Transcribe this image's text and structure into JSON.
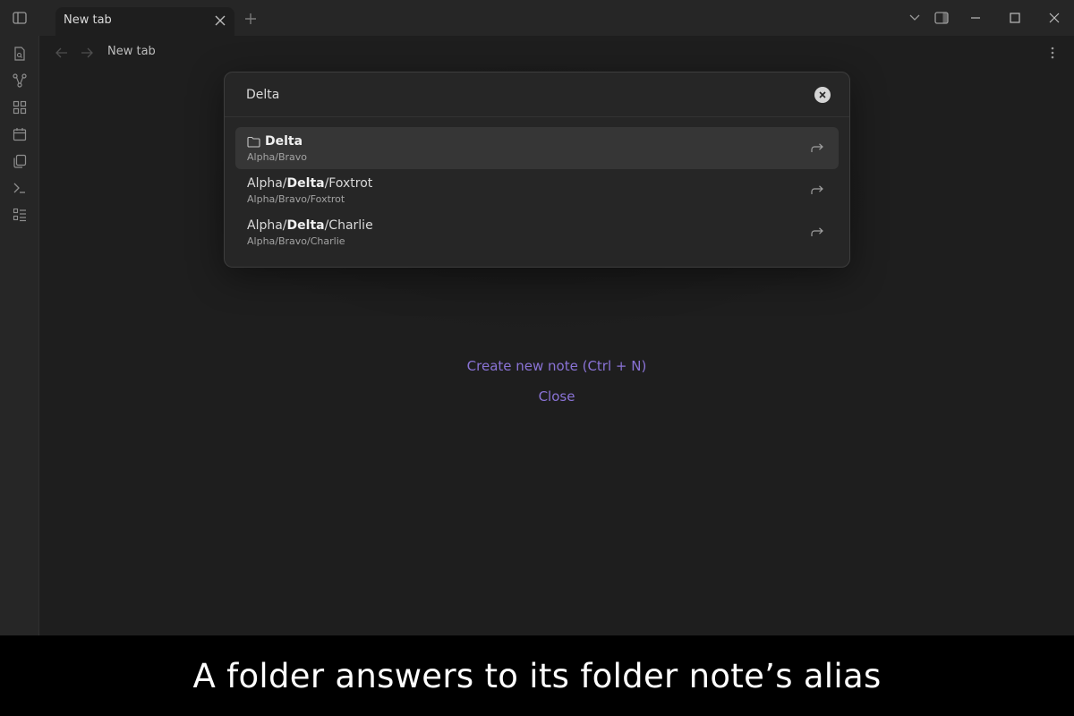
{
  "tabs": [
    {
      "title": "New tab"
    }
  ],
  "view": {
    "title": "New tab"
  },
  "ribbon": {
    "items": [
      "quick-switcher-icon",
      "graph-icon",
      "canvas-icon",
      "calendar-icon",
      "templates-icon",
      "terminal-icon",
      "outline-icon"
    ]
  },
  "search": {
    "value": "Delta",
    "results": [
      {
        "pre": "",
        "match": "Delta",
        "post": "",
        "path": "Alpha/Bravo",
        "is_folder": true,
        "selected": true
      },
      {
        "pre": "Alpha/",
        "match": "Delta",
        "post": "/Foxtrot",
        "path": "Alpha/Bravo/Foxtrot",
        "is_folder": false,
        "selected": false
      },
      {
        "pre": "Alpha/",
        "match": "Delta",
        "post": "/Charlie",
        "path": "Alpha/Bravo/Charlie",
        "is_folder": false,
        "selected": false
      }
    ]
  },
  "empty_state": {
    "create_label": "Create new note (Ctrl + N)",
    "close_label": "Close"
  },
  "caption": "A folder answers to its folder note’s alias",
  "colors": {
    "accent": "#8a73d6",
    "background": "#1e1e1e",
    "panel": "#262626"
  }
}
